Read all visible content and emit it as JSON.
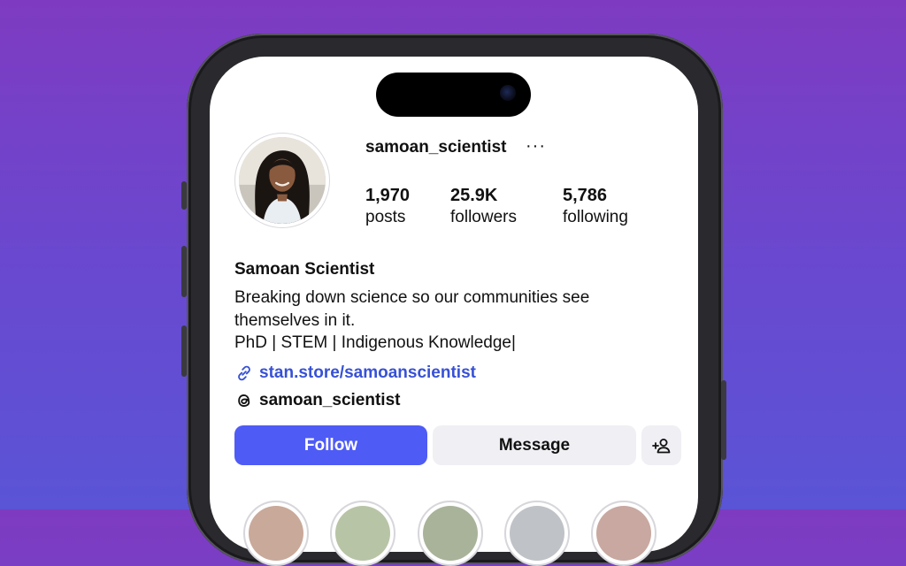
{
  "profile": {
    "username": "samoan_scientist",
    "more_label": "···",
    "display_name": "Samoan Scientist",
    "bio_lines": [
      "Breaking down science so our communities see",
      "themselves in it.",
      "PhD | STEM | Indigenous Knowledge|"
    ],
    "link": "stan.store/samoanscientist",
    "threads_handle": "samoan_scientist"
  },
  "stats": [
    {
      "value": "1,970",
      "label": "posts"
    },
    {
      "value": "25.9K",
      "label": "followers"
    },
    {
      "value": "5,786",
      "label": "following"
    }
  ],
  "actions": {
    "follow_label": "Follow",
    "message_label": "Message",
    "add_icon": "person-add-icon"
  },
  "icons": {
    "link": "link-icon",
    "threads": "threads-icon",
    "more": "more-horizontal-icon"
  },
  "colors": {
    "follow_button": "#4f5bf5",
    "link_text": "#3751d6",
    "secondary_button": "#efeff4",
    "background_top": "#7e3bc1",
    "background_bottom": "#5a54d6"
  }
}
